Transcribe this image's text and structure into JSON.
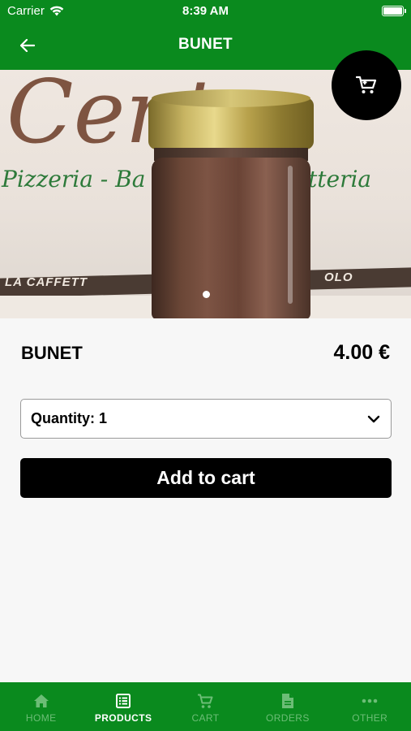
{
  "status_bar": {
    "carrier": "Carrier",
    "time": "8:39 AM"
  },
  "header": {
    "title": "BUNET"
  },
  "hero": {
    "image_text_brand": "Centro",
    "image_text_sub_left": "Pizzeria - Ba",
    "image_text_sub_right": "tteria",
    "image_text_band_left": "LA CAFFETT",
    "image_text_band_right": "OLO",
    "carousel_pages": 1,
    "carousel_active": 1
  },
  "product": {
    "name": "BUNET",
    "price": "4.00 €"
  },
  "quantity": {
    "label": "Quantity: 1"
  },
  "actions": {
    "add_to_cart": "Add to cart"
  },
  "tabs": [
    {
      "label": "HOME",
      "icon": "home-icon",
      "active": false
    },
    {
      "label": "PRODUCTS",
      "icon": "list-icon",
      "active": true
    },
    {
      "label": "CART",
      "icon": "cart-icon",
      "active": false
    },
    {
      "label": "ORDERS",
      "icon": "document-icon",
      "active": false
    },
    {
      "label": "OTHER",
      "icon": "more-icon",
      "active": false
    }
  ],
  "colors": {
    "brand_green": "#0a8a1e",
    "inactive_tab": "#6cbd76",
    "primary_button": "#000000"
  }
}
